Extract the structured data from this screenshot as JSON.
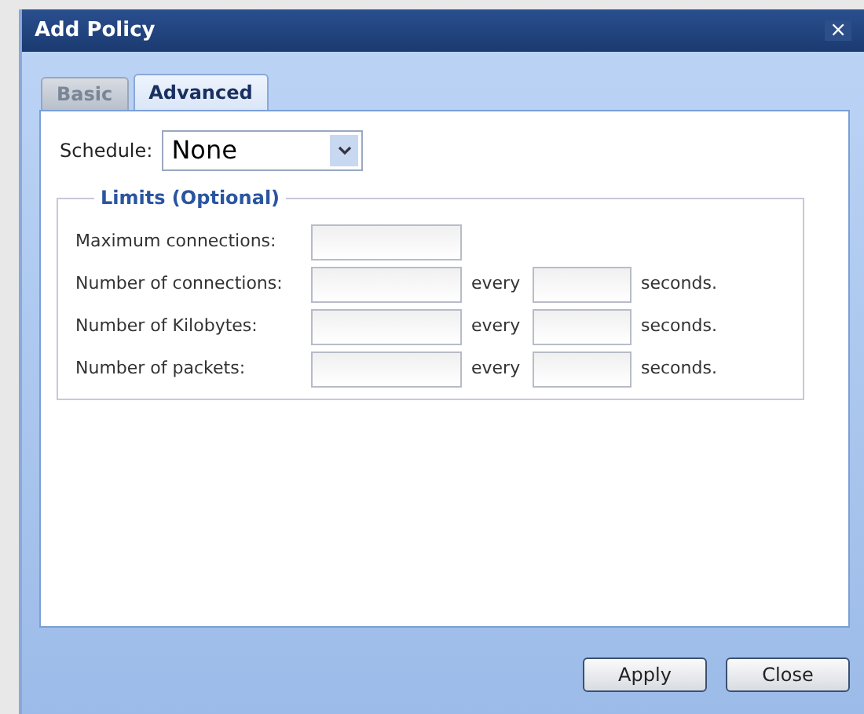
{
  "window": {
    "title": "Add Policy",
    "close": "×"
  },
  "tabs": [
    {
      "label": "Basic",
      "selected": false
    },
    {
      "label": "Advanced",
      "selected": true
    }
  ],
  "schedule": {
    "label": "Schedule:",
    "value": "None"
  },
  "limits": {
    "legend": "Limits (Optional)",
    "rows": [
      {
        "kind": "single",
        "label": "Maximum connections:"
      },
      {
        "kind": "rate",
        "label": "Number of connections:",
        "every": "every",
        "unit": "seconds."
      },
      {
        "kind": "rate",
        "label": "Number of Kilobytes:",
        "every": "every",
        "unit": "seconds."
      },
      {
        "kind": "rate",
        "label": "Number of packets:",
        "every": "every",
        "unit": "seconds."
      }
    ]
  },
  "buttons": [
    "Apply",
    "Close"
  ]
}
